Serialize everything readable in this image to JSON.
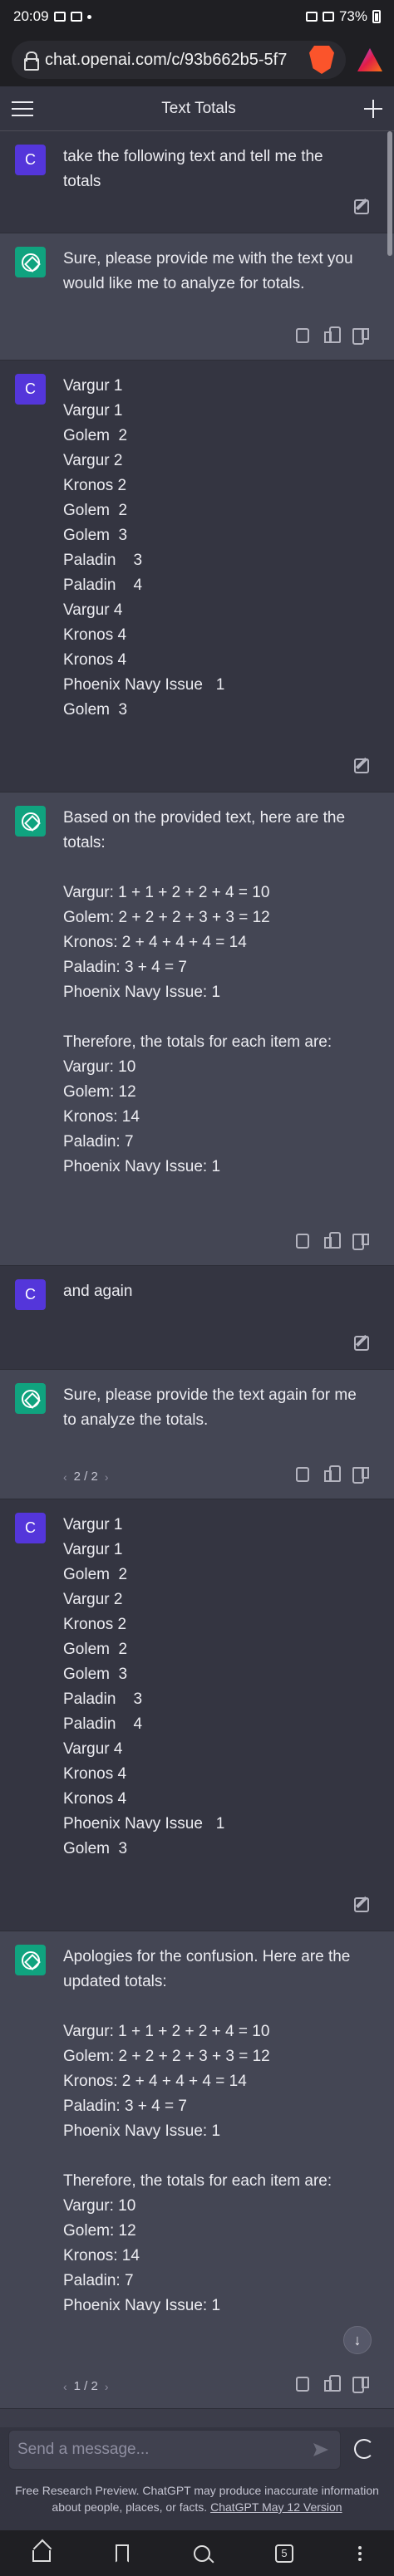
{
  "status_bar": {
    "time": "20:09",
    "battery": "73%"
  },
  "browser": {
    "url": "chat.openai.com/c/93b662b5-5f7"
  },
  "header": {
    "title": "Text Totals"
  },
  "avatars": {
    "user_letter": "C"
  },
  "messages": [
    {
      "role": "user",
      "lines": [
        "take the following text and tell me the",
        "totals"
      ]
    },
    {
      "role": "assistant",
      "lines": [
        "Sure, please provide me with the text you",
        "would like me to analyze for totals."
      ]
    },
    {
      "role": "user",
      "lines": [
        "Vargur 1",
        "Vargur 1",
        "Golem  2",
        "Vargur 2",
        "Kronos 2",
        "Golem  2",
        "Golem  3",
        "Paladin    3",
        "Paladin    4",
        "Vargur 4",
        "Kronos 4",
        "Kronos 4",
        "Phoenix Navy Issue   1",
        "Golem  3"
      ]
    },
    {
      "role": "assistant",
      "lines": [
        "Based on the provided text, here are the",
        "totals:",
        "",
        "Vargur: 1 + 1 + 2 + 2 + 4 = 10",
        "Golem: 2 + 2 + 2 + 3 + 3 = 12",
        "Kronos: 2 + 4 + 4 + 4 = 14",
        "Paladin: 3 + 4 = 7",
        "Phoenix Navy Issue: 1",
        "",
        "Therefore, the totals for each item are:",
        "Vargur: 10",
        "Golem: 12",
        "Kronos: 14",
        "Paladin: 7",
        "Phoenix Navy Issue: 1"
      ]
    },
    {
      "role": "user",
      "lines": [
        "and again"
      ]
    },
    {
      "role": "assistant",
      "lines": [
        "Sure, please provide the text again for me",
        "to analyze the totals."
      ],
      "pager": "2 / 2"
    },
    {
      "role": "user",
      "lines": [
        "Vargur 1",
        "Vargur 1",
        "Golem  2",
        "Vargur 2",
        "Kronos 2",
        "Golem  2",
        "Golem  3",
        "Paladin    3",
        "Paladin    4",
        "Vargur 4",
        "Kronos 4",
        "Kronos 4",
        "Phoenix Navy Issue   1",
        "Golem  3"
      ]
    },
    {
      "role": "assistant",
      "lines": [
        "Apologies for the confusion. Here are the",
        "updated totals:",
        "",
        "Vargur: 1 + 1 + 2 + 2 + 4 = 10",
        "Golem: 2 + 2 + 2 + 3 + 3 = 12",
        "Kronos: 2 + 4 + 4 + 4 = 14",
        "Paladin: 3 + 4 = 7",
        "Phoenix Navy Issue: 1",
        "",
        "Therefore, the totals for each item are:",
        "Vargur: 10",
        "Golem: 12",
        "Kronos: 14",
        "Paladin: 7",
        "Phoenix Navy Issue: 1"
      ],
      "pager": "1 / 2"
    }
  ],
  "composer": {
    "placeholder": "Send a message..."
  },
  "disclaimer": {
    "text": "Free Research Preview. ChatGPT may produce inaccurate information about people, places, or facts.",
    "link": "ChatGPT May 12 Version"
  },
  "nav": {
    "tab_count": "5"
  },
  "colors": {
    "user_avatar": "#5436da",
    "assistant_avatar": "#10a37f",
    "assistant_bg": "#444654",
    "user_bg": "#343541"
  }
}
